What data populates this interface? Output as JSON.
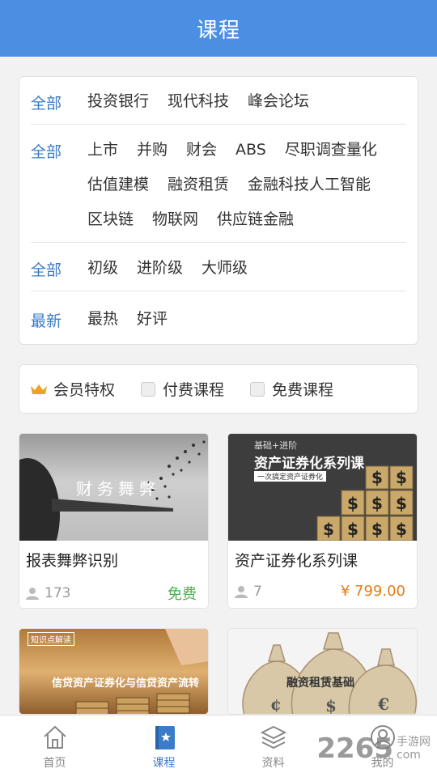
{
  "header": {
    "title": "课程"
  },
  "filters": {
    "row1": {
      "all": "全部",
      "options": [
        "投资银行",
        "现代科技",
        "峰会论坛"
      ]
    },
    "row2": {
      "all": "全部",
      "options": [
        "上市",
        "并购",
        "财会",
        "ABS",
        "尽职调查",
        "量化",
        "估值建模",
        "融资租赁",
        "金融科技",
        "人工智能",
        "区块链",
        "物联网",
        "供应链金融"
      ]
    },
    "row3": {
      "all": "全部",
      "options": [
        "初级",
        "进阶级",
        "大师级"
      ]
    },
    "row4": {
      "all": "最新",
      "options": [
        "最热",
        "好评"
      ]
    }
  },
  "member": {
    "vip": "会员特权",
    "paid": "付费课程",
    "free": "免费课程"
  },
  "courses": [
    {
      "title": "报表舞弊识别",
      "learners": "173",
      "price": "免费",
      "thumb_text": "财务舞弊"
    },
    {
      "title": "资产证券化系列课",
      "learners": "7",
      "price": "¥ 799.00",
      "thumb_text": "资产证券化系列课",
      "thumb_tag": "基础+进阶",
      "thumb_sub": "一次搞定资产证券化"
    },
    {
      "thumb_tag": "知识点解读",
      "thumb_text": "信贷资产证券化与信贷资产流转"
    },
    {
      "thumb_text": "融资租赁基础"
    }
  ],
  "nav": {
    "home": "首页",
    "course": "课程",
    "materials": "资料",
    "mine": "我的"
  },
  "watermark": {
    "brand": "2265",
    "sub1": "手游网",
    "sub2": "com"
  },
  "colors": {
    "accent": "#4b8fe3",
    "link": "#3a7cc8",
    "free": "#4caf50",
    "price": "#e57c17"
  }
}
